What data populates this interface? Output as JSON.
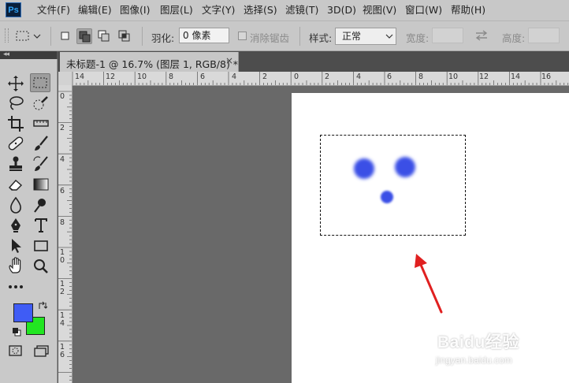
{
  "app": {
    "logo_text": "Ps",
    "brand_color": "#2fa3f7"
  },
  "menu": {
    "items": [
      "文件(F)",
      "编辑(E)",
      "图像(I)",
      "图层(L)",
      "文字(Y)",
      "选择(S)",
      "滤镜(T)",
      "3D(D)",
      "视图(V)",
      "窗口(W)",
      "帮助(H)"
    ]
  },
  "options": {
    "feather_label": "羽化:",
    "feather_value": "0 像素",
    "antialias_label": "消除锯齿",
    "style_label": "样式:",
    "style_value": "正常",
    "width_label": "宽度:",
    "height_label": "高度:"
  },
  "document": {
    "tab_title": "未标题-1 @ 16.7% (图层 1, RGB/8) *",
    "close_glyph": "×"
  },
  "ruler_top": [
    "14",
    "12",
    "10",
    "8",
    "6",
    "4",
    "2",
    "0",
    "2",
    "4",
    "6",
    "8",
    "10",
    "12",
    "14",
    "16"
  ],
  "ruler_left": [
    "0",
    "2",
    "4",
    "6",
    "8",
    "1\n0",
    "1\n2",
    "1\n4",
    "1\n6"
  ],
  "colors": {
    "foreground": "#3f5cf5",
    "background": "#22e622",
    "dots": "#3b50e6",
    "annotation_arrow": "#e02020",
    "canvas": "#ffffff",
    "pasteboard": "#696969"
  },
  "watermark": {
    "line1": "Baidu经验",
    "line2": "jingyan.baidu.com"
  }
}
